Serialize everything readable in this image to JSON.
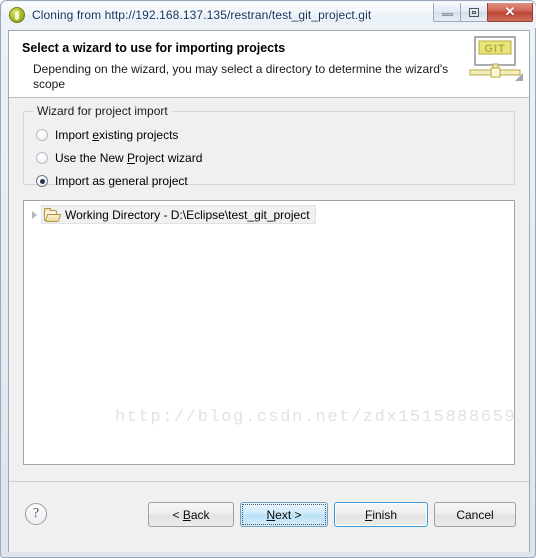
{
  "window": {
    "title": "Cloning from http://192.168.137.135/restran/test_git_project.git",
    "app_icon": "eclipse-git-icon",
    "controls": {
      "minimize_label": "minimize-icon",
      "maximize_label": "maximize-icon",
      "close_label": "✕"
    }
  },
  "header": {
    "title": "Select a wizard to use for importing projects",
    "description": "Depending on the wizard, you may select a directory to determine the wizard's scope",
    "banner_text": "GIT"
  },
  "group": {
    "label": "Wizard for project import",
    "options": [
      {
        "label_before": "Import ",
        "mnemonic": "e",
        "label_after": "xisting projects",
        "checked": false
      },
      {
        "label_before": "Use the New ",
        "mnemonic": "P",
        "label_after": "roject wizard",
        "checked": false
      },
      {
        "label_before": "Import as ",
        "mnemonic": "g",
        "label_after": "eneral project",
        "checked": true
      }
    ]
  },
  "tree": {
    "items": [
      {
        "label": "Working Directory - D:\\Eclipse\\test_git_project",
        "icon": "open-folder-icon",
        "expander": "collapsed",
        "selected": true
      }
    ]
  },
  "watermark": "http://blog.csdn.net/zdx1515888659",
  "buttons": {
    "help": "?",
    "back": {
      "before": "< ",
      "mnemonic": "B",
      "after": "ack"
    },
    "next": {
      "before": "",
      "mnemonic": "N",
      "after": "ext >"
    },
    "finish": {
      "before": "",
      "mnemonic": "F",
      "after": "inish"
    },
    "cancel": {
      "before": "Cancel",
      "mnemonic": "",
      "after": ""
    }
  },
  "colors": {
    "accent_blue": "#3c9bd4",
    "focus_blue": "#b9e0f6",
    "close_red": "#bc4434",
    "banner_yellow": "#e8e57a",
    "dialog_bg": "#f0f0f0"
  }
}
